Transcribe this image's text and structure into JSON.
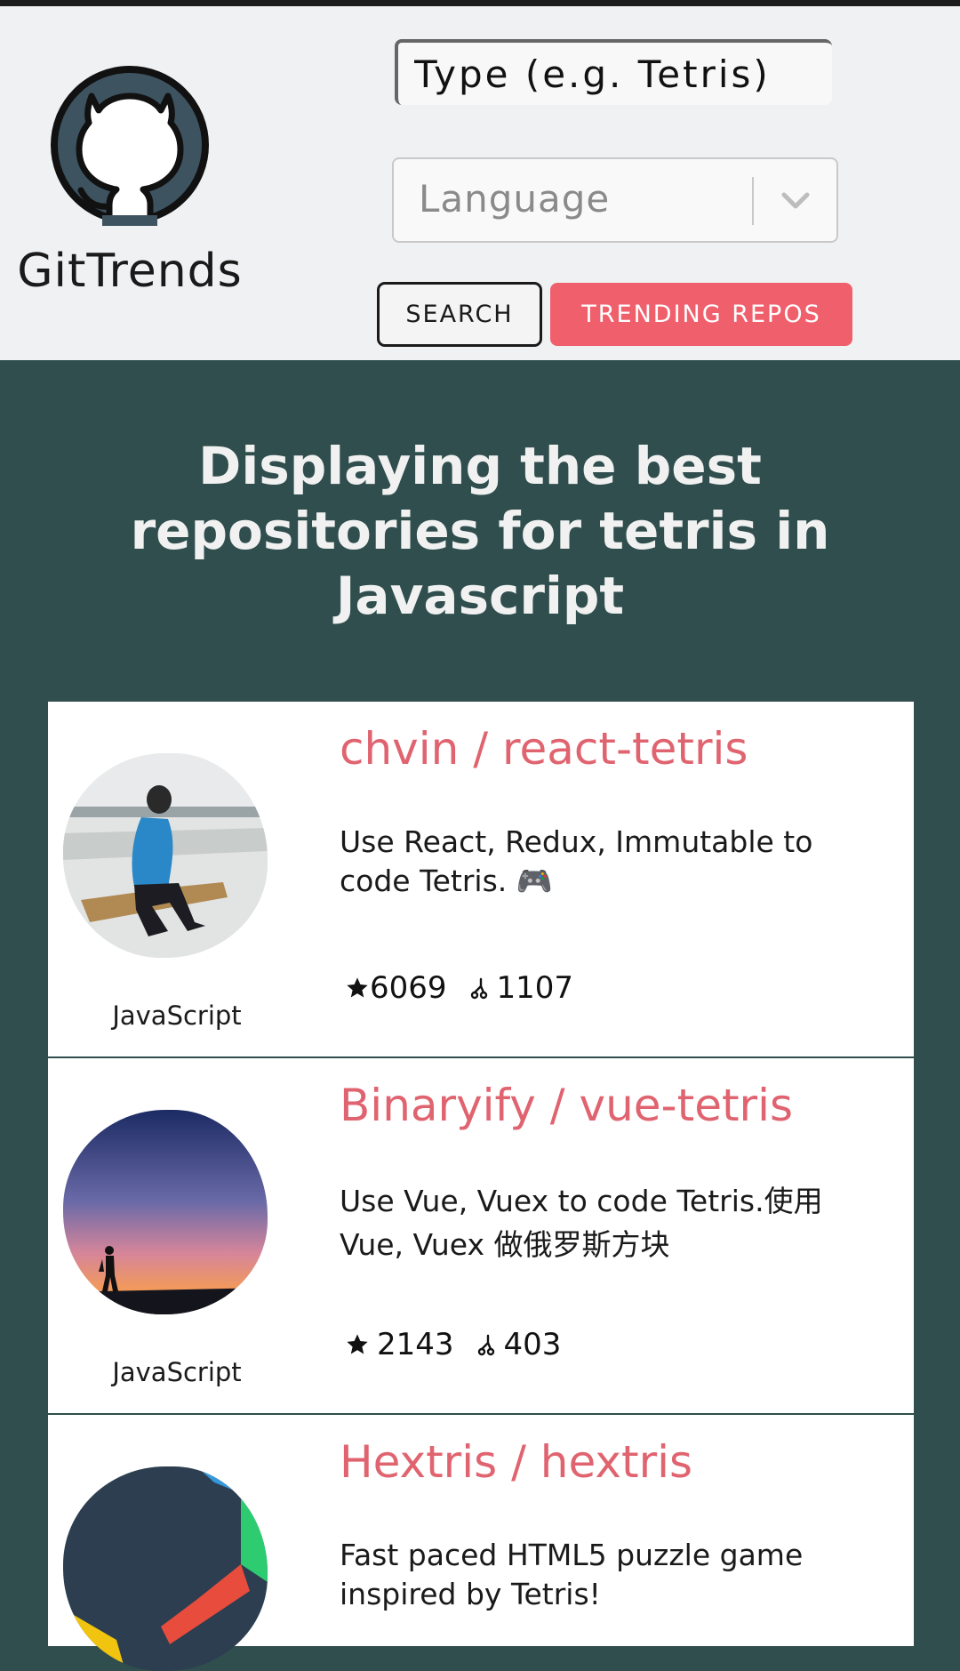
{
  "header": {
    "brand": "GitTrends",
    "search_placeholder": "Type (e.g. Tetris)",
    "language_placeholder": "Language",
    "search_button": "SEARCH",
    "trending_button": "TRENDING REPOS"
  },
  "headline": "Displaying the best repositories for tetris in Javascript",
  "repos": [
    {
      "title": "chvin / react-tetris",
      "description": "Use React, Redux, Immutable to code Tetris. 🎮",
      "stars": "6069",
      "forks": "1107",
      "language": "JavaScript"
    },
    {
      "title": "Binaryify / vue-tetris",
      "description": "Use Vue, Vuex to code Tetris.使用 Vue, Vuex 做俄罗斯方块",
      "stars": "2143",
      "forks": "403",
      "language": "JavaScript"
    },
    {
      "title": "Hextris / hextris",
      "description": "Fast paced HTML5 puzzle game inspired by Tetris!"
    }
  ],
  "colors": {
    "accent": "#ef5f6c",
    "title": "#e06470",
    "background": "#2f4e4d"
  }
}
